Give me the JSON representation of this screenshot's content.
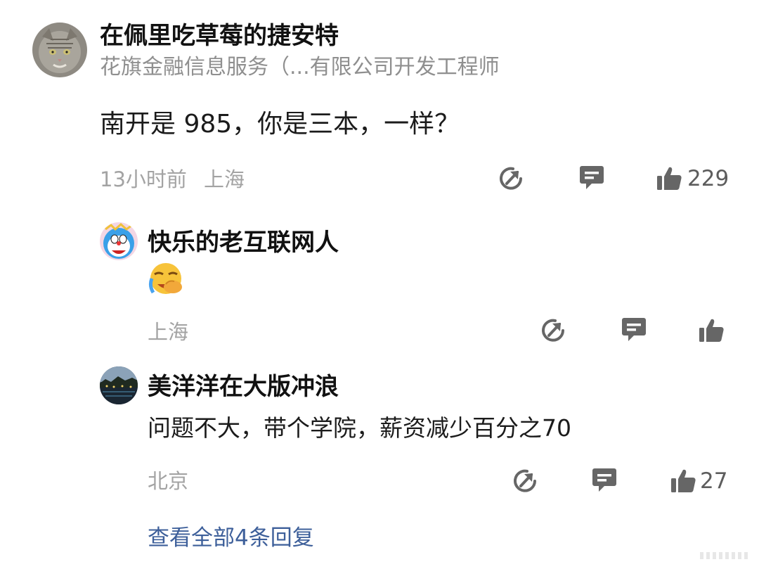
{
  "main_comment": {
    "author": "在佩里吃草莓的捷安特",
    "subtitle": "花旗金融信息服务（...有限公司开发工程师",
    "text": "南开是 985，你是三本，一样？",
    "time": "13小时前",
    "location": "上海",
    "like_count": "229",
    "avatar_icon": "cat-avatar"
  },
  "replies": [
    {
      "author": "快乐的老互联网人",
      "emoji_icon": "facepalm-crying-emoji",
      "location": "上海",
      "like_count": "",
      "avatar_icon": "doraemon-avatar"
    },
    {
      "author": "美洋洋在大版冲浪",
      "text": "问题不大，带个学院，薪资减少百分之70",
      "location": "北京",
      "like_count": "27",
      "avatar_icon": "night-lake-avatar"
    }
  ],
  "view_all_label": "查看全部4条回复",
  "icons": {
    "share": "share-icon",
    "reply": "comment-icon",
    "like": "thumbs-up-icon"
  },
  "colors": {
    "icon_gray": "#666666",
    "meta_gray": "#a3a3a3",
    "link_blue": "#3d5f9a"
  }
}
